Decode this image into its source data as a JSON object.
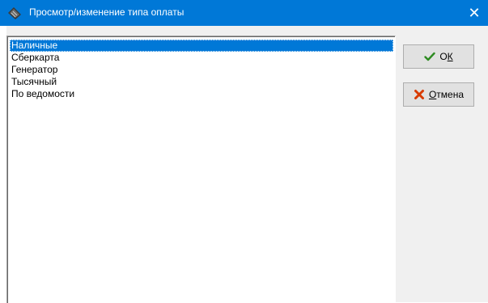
{
  "window": {
    "title": "Просмотр/изменение типа оплаты",
    "close_glyph": "✕",
    "title_icon": "app-icon"
  },
  "colors": {
    "titlebar": "#0078d7",
    "selection": "#0078d7",
    "ok_check": "#2e8b22",
    "cancel_x": "#d83b01"
  },
  "list": {
    "items": [
      "Наличные",
      "Сберкарта",
      "Генератор",
      "Тысячный",
      "По ведомости"
    ],
    "selected_index": 0
  },
  "buttons": {
    "ok": {
      "label_pre": "О",
      "label_under": "К",
      "label_post": "",
      "icon": "check-icon"
    },
    "cancel": {
      "label_pre": "",
      "label_under": "О",
      "label_post": "тмена",
      "icon": "cross-icon"
    }
  }
}
